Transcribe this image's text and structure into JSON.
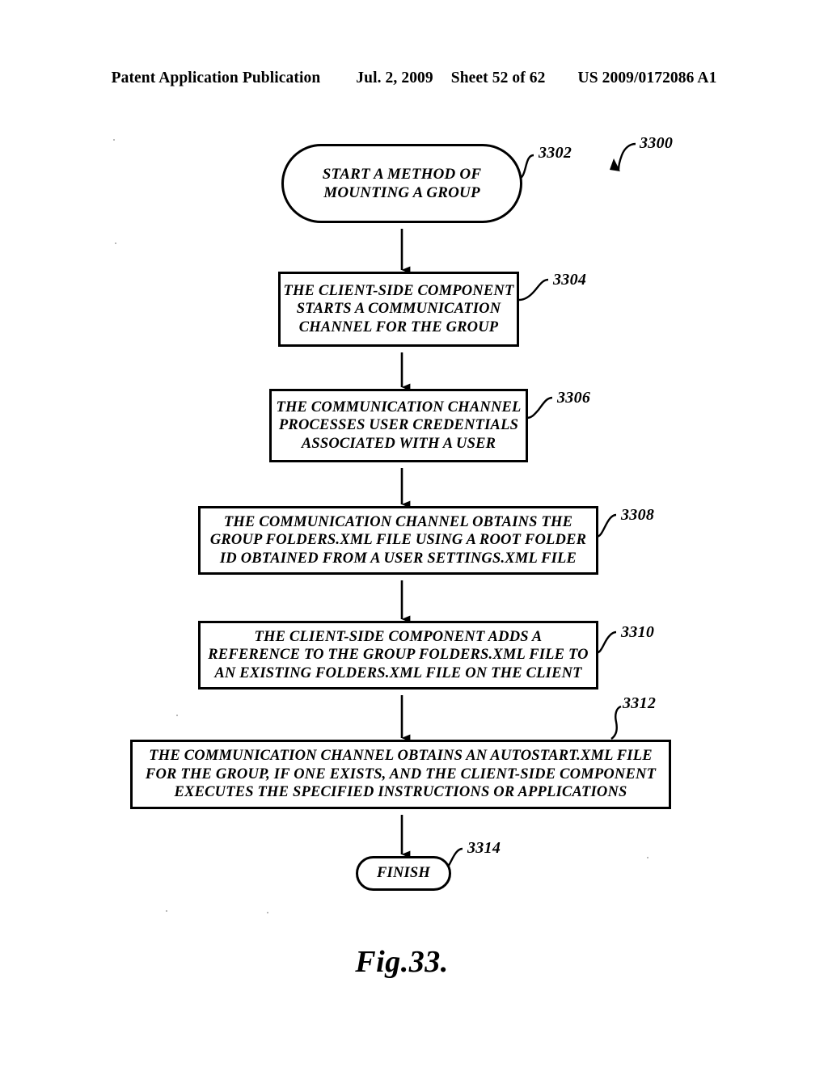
{
  "header": {
    "publication": "Patent Application Publication",
    "date": "Jul. 2, 2009",
    "sheet": "Sheet 52 of 62",
    "patent_number": "US 2009/0172086 A1"
  },
  "figure": {
    "caption": "Fig.33.",
    "figure_ref": "3300"
  },
  "flowchart": {
    "type": "flowchart",
    "orientation": "top-to-bottom",
    "nodes": [
      {
        "id": "3302",
        "ref": "3302",
        "shape": "terminator",
        "lines": [
          "START A METHOD OF",
          "MOUNTING A GROUP"
        ]
      },
      {
        "id": "3304",
        "ref": "3304",
        "shape": "process",
        "lines": [
          "THE CLIENT-SIDE COMPONENT",
          "STARTS A COMMUNICATION",
          "CHANNEL FOR THE GROUP"
        ]
      },
      {
        "id": "3306",
        "ref": "3306",
        "shape": "process",
        "lines": [
          "THE COMMUNICATION CHANNEL",
          "PROCESSES USER CREDENTIALS",
          "ASSOCIATED WITH A USER"
        ]
      },
      {
        "id": "3308",
        "ref": "3308",
        "shape": "process",
        "lines": [
          "THE COMMUNICATION CHANNEL OBTAINS THE",
          "GROUP FOLDERS.XML FILE USING A ROOT FOLDER",
          "ID OBTAINED FROM A USER SETTINGS.XML FILE"
        ]
      },
      {
        "id": "3310",
        "ref": "3310",
        "shape": "process",
        "lines": [
          "THE CLIENT-SIDE COMPONENT ADDS A",
          "REFERENCE TO THE GROUP FOLDERS.XML FILE TO",
          "AN EXISTING FOLDERS.XML FILE ON THE CLIENT"
        ]
      },
      {
        "id": "3312",
        "ref": "3312",
        "shape": "process",
        "lines": [
          "THE COMMUNICATION CHANNEL OBTAINS AN AUTOSTART.XML FILE",
          "FOR THE GROUP, IF ONE EXISTS, AND THE CLIENT-SIDE COMPONENT",
          "EXECUTES THE SPECIFIED INSTRUCTIONS OR APPLICATIONS"
        ]
      },
      {
        "id": "3314",
        "ref": "3314",
        "shape": "terminator",
        "lines": [
          "FINISH"
        ]
      }
    ],
    "edges": [
      {
        "from": "3302",
        "to": "3304",
        "style": "arrow"
      },
      {
        "from": "3304",
        "to": "3306",
        "style": "arrow"
      },
      {
        "from": "3306",
        "to": "3308",
        "style": "arrow"
      },
      {
        "from": "3308",
        "to": "3310",
        "style": "arrow"
      },
      {
        "from": "3310",
        "to": "3312",
        "style": "arrow"
      },
      {
        "from": "3312",
        "to": "3314",
        "style": "arrow"
      }
    ]
  },
  "colors": {
    "ink": "#000000",
    "paper": "#ffffff"
  }
}
